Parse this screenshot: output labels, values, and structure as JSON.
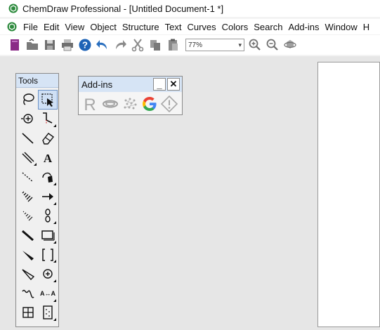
{
  "window": {
    "title": "ChemDraw Professional - [Untitled Document-1 *]"
  },
  "menubar": {
    "items": [
      "File",
      "Edit",
      "View",
      "Object",
      "Structure",
      "Text",
      "Curves",
      "Colors",
      "Search",
      "Add-ins",
      "Window",
      "H"
    ]
  },
  "toolbar": {
    "buttons": [
      "new-document",
      "open",
      "save",
      "print",
      "help",
      "undo",
      "redo",
      "cut",
      "copy",
      "paste"
    ],
    "zoom_value": "77%",
    "zoom_buttons": [
      "zoom-in",
      "zoom-out",
      "rotate-view"
    ]
  },
  "tools_palette": {
    "title": "Tools",
    "selected_tool": "marquee"
  },
  "addins_panel": {
    "title": "Add-ins",
    "minimize_label": "_",
    "close_label": "✕",
    "icons": [
      "r-icon",
      "ring-icon",
      "mesh-icon",
      "google-icon",
      "warning-icon"
    ]
  },
  "colors": {
    "accent_panel_header": "#d6e4f5",
    "workspace_bg": "#e6e6e6",
    "google_blue": "#4285f4",
    "google_red": "#ea4335",
    "google_yellow": "#fbbc05",
    "google_green": "#34a853",
    "help_blue": "#1e63b6"
  }
}
